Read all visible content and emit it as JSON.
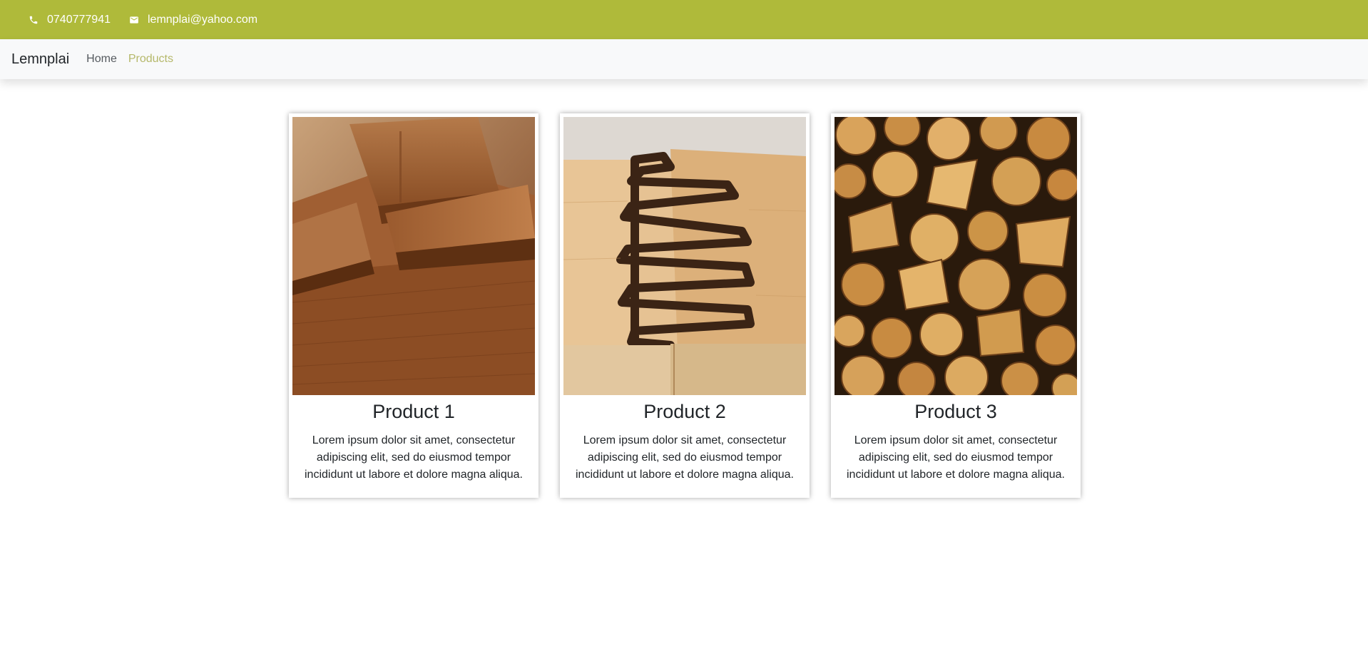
{
  "topbar": {
    "phone": "0740777941",
    "email": "lemnplai@yahoo.com",
    "phone_icon": "phone-icon",
    "email_icon": "mail-icon",
    "background": "#afba3a"
  },
  "navbar": {
    "brand": "Lemnplai",
    "links": [
      {
        "label": "Home",
        "active": false
      },
      {
        "label": "Products",
        "active": true
      }
    ],
    "active_color": "#b5b86a"
  },
  "products": [
    {
      "title": "Product 1",
      "text": "Lorem ipsum dolor sit amet, consectetur adipiscing elit, sed do eiusmod tempor incididunt ut labore et dolore magna aliqua.",
      "image": "stacked-wood-planks-image"
    },
    {
      "title": "Product 2",
      "text": "Lorem ipsum dolor sit amet, consectetur adipiscing elit, sed do eiusmod tempor incididunt ut labore et dolore magna aliqua.",
      "image": "finger-joint-wood-image"
    },
    {
      "title": "Product 3",
      "text": "Lorem ipsum dolor sit amet, consectetur adipiscing elit, sed do eiusmod tempor incididunt ut labore et dolore magna aliqua.",
      "image": "firewood-logs-image"
    }
  ]
}
